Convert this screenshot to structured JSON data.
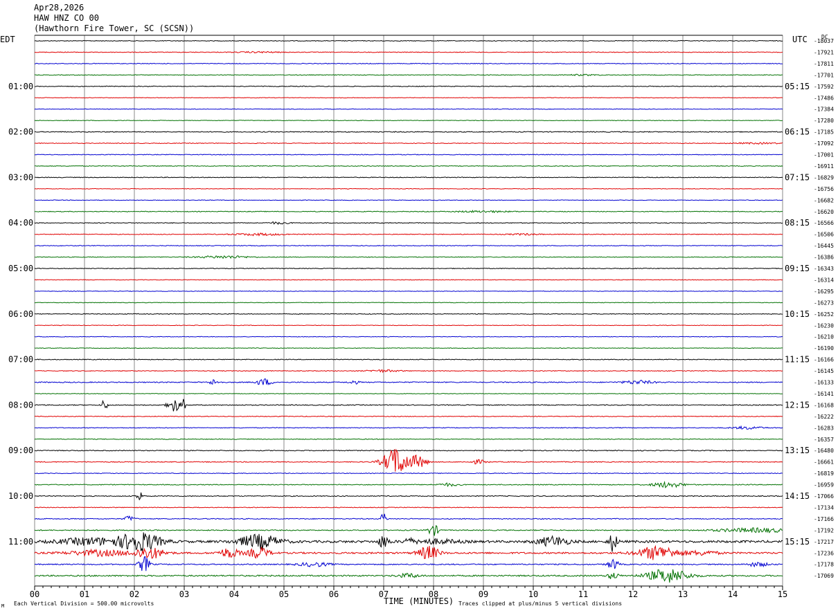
{
  "header": {
    "date": "Apr28,2026",
    "station": "HAW HNZ CO 00",
    "location": "(Hawthorn Fire Tower, SC (SCSN))"
  },
  "left_timezone": "EDT",
  "right_timezone": "UTC",
  "dc_label": "DC",
  "footer": {
    "scale_note": "Each Vertical Division =  500.00 microvolts",
    "xlabel": "TIME (MINUTES)",
    "clip_note": "Traces clipped at plus/minus 5 vertical divisions",
    "corner_mark": "M"
  },
  "colors": {
    "trace_cycle": [
      "#000000",
      "#e00000",
      "#0000d0",
      "#007000"
    ],
    "grid": "#8a8a8a"
  },
  "chart_data": {
    "type": "line",
    "title": "HAW HNZ CO 00",
    "xlabel": "TIME (MINUTES)",
    "xlim": [
      0,
      15
    ],
    "x_ticks": [
      "00",
      "01",
      "02",
      "03",
      "04",
      "05",
      "06",
      "07",
      "08",
      "09",
      "10",
      "11",
      "12",
      "13",
      "14",
      "15"
    ],
    "trace_minutes": 15,
    "left_hour_labels": [
      "01:00",
      "02:00",
      "03:00",
      "04:00",
      "05:00",
      "06:00",
      "07:00",
      "08:00",
      "09:00",
      "10:00",
      "11:00"
    ],
    "right_hour_labels": [
      "05:15",
      "06:15",
      "07:15",
      "08:15",
      "09:15",
      "10:15",
      "11:15",
      "12:15",
      "13:15",
      "14:15",
      "15:15"
    ],
    "dc_offsets": [
      -18037,
      -17921,
      -17811,
      -17701,
      -17592,
      -17486,
      -17384,
      -17280,
      -17185,
      -17092,
      -17001,
      -16911,
      -16829,
      -16756,
      -16682,
      -16620,
      -16566,
      -16506,
      -16445,
      -16386,
      -16343,
      -16314,
      -16295,
      -16273,
      -16252,
      -16230,
      -16210,
      -16190,
      -16166,
      -16145,
      -16133,
      -16141,
      -16168,
      -16222,
      -16283,
      -16357,
      -16480,
      -16661,
      -16819,
      -16959,
      -17066,
      -17134,
      -17166,
      -17192,
      -17217,
      -17236,
      -17178,
      -17069
    ],
    "activity": [
      {
        "row": 0,
        "level": 0.5,
        "bursts": []
      },
      {
        "row": 1,
        "level": 0.5,
        "bursts": [
          [
            4.5,
            0.4,
            0.8
          ]
        ]
      },
      {
        "row": 2,
        "level": 0.5,
        "bursts": []
      },
      {
        "row": 3,
        "level": 0.5,
        "bursts": [
          [
            11.0,
            0.3,
            0.8
          ]
        ]
      },
      {
        "row": 4,
        "level": 0.5,
        "bursts": []
      },
      {
        "row": 5,
        "level": 0.4,
        "bursts": []
      },
      {
        "row": 6,
        "level": 0.4,
        "bursts": []
      },
      {
        "row": 7,
        "level": 0.4,
        "bursts": []
      },
      {
        "row": 8,
        "level": 0.6,
        "bursts": []
      },
      {
        "row": 9,
        "level": 0.5,
        "bursts": [
          [
            14.5,
            0.5,
            0.8
          ]
        ]
      },
      {
        "row": 10,
        "level": 0.5,
        "bursts": []
      },
      {
        "row": 11,
        "level": 0.5,
        "bursts": []
      },
      {
        "row": 12,
        "level": 0.5,
        "bursts": []
      },
      {
        "row": 13,
        "level": 0.4,
        "bursts": []
      },
      {
        "row": 14,
        "level": 0.4,
        "bursts": []
      },
      {
        "row": 15,
        "level": 0.5,
        "bursts": [
          [
            9.0,
            0.5,
            1.2
          ]
        ]
      },
      {
        "row": 16,
        "level": 0.5,
        "bursts": [
          [
            4.9,
            0.2,
            1.5
          ]
        ]
      },
      {
        "row": 17,
        "level": 0.5,
        "bursts": [
          [
            4.5,
            0.5,
            1.5
          ],
          [
            9.8,
            0.3,
            1.0
          ]
        ]
      },
      {
        "row": 18,
        "level": 0.5,
        "bursts": []
      },
      {
        "row": 19,
        "level": 0.5,
        "bursts": [
          [
            3.8,
            0.5,
            1.8
          ]
        ]
      },
      {
        "row": 20,
        "level": 0.5,
        "bursts": []
      },
      {
        "row": 21,
        "level": 0.4,
        "bursts": []
      },
      {
        "row": 22,
        "level": 0.4,
        "bursts": []
      },
      {
        "row": 23,
        "level": 0.4,
        "bursts": []
      },
      {
        "row": 24,
        "level": 0.5,
        "bursts": []
      },
      {
        "row": 25,
        "level": 0.4,
        "bursts": []
      },
      {
        "row": 26,
        "level": 0.4,
        "bursts": []
      },
      {
        "row": 27,
        "level": 0.4,
        "bursts": []
      },
      {
        "row": 28,
        "level": 0.5,
        "bursts": []
      },
      {
        "row": 29,
        "level": 0.5,
        "bursts": [
          [
            7.0,
            0.3,
            1.5
          ]
        ]
      },
      {
        "row": 30,
        "level": 0.7,
        "bursts": [
          [
            3.6,
            0.1,
            4
          ],
          [
            4.6,
            0.15,
            5
          ],
          [
            6.4,
            0.1,
            2.5
          ],
          [
            12.1,
            0.3,
            2.5
          ]
        ]
      },
      {
        "row": 31,
        "level": 0.4,
        "bursts": []
      },
      {
        "row": 32,
        "level": 0.6,
        "bursts": [
          [
            1.4,
            0.05,
            10
          ],
          [
            2.8,
            0.12,
            10
          ],
          [
            3.0,
            0.03,
            10
          ]
        ]
      },
      {
        "row": 33,
        "level": 0.5,
        "bursts": []
      },
      {
        "row": 34,
        "level": 0.5,
        "bursts": [
          [
            14.3,
            0.3,
            2
          ]
        ]
      },
      {
        "row": 35,
        "level": 0.5,
        "bursts": []
      },
      {
        "row": 36,
        "level": 0.6,
        "bursts": []
      },
      {
        "row": 37,
        "level": 0.6,
        "bursts": [
          [
            7.25,
            0.25,
            20
          ],
          [
            7.7,
            0.15,
            9
          ],
          [
            8.9,
            0.15,
            3
          ]
        ]
      },
      {
        "row": 38,
        "level": 0.5,
        "bursts": []
      },
      {
        "row": 39,
        "level": 0.6,
        "bursts": [
          [
            12.7,
            0.3,
            4
          ],
          [
            8.3,
            0.2,
            2
          ]
        ]
      },
      {
        "row": 40,
        "level": 0.6,
        "bursts": [
          [
            2.1,
            0.05,
            10
          ]
        ]
      },
      {
        "row": 41,
        "level": 0.5,
        "bursts": []
      },
      {
        "row": 42,
        "level": 0.6,
        "bursts": [
          [
            7.0,
            0.05,
            10
          ],
          [
            1.9,
            0.1,
            4
          ]
        ]
      },
      {
        "row": 43,
        "level": 0.7,
        "bursts": [
          [
            8.0,
            0.1,
            8
          ],
          [
            14.5,
            0.8,
            3
          ]
        ]
      },
      {
        "row": 44,
        "level": 1.6,
        "bursts": [
          [
            1.1,
            0.6,
            5
          ],
          [
            2.1,
            0.4,
            14
          ],
          [
            4.5,
            0.4,
            10
          ],
          [
            7.0,
            0.1,
            9
          ],
          [
            7.5,
            0.05,
            9
          ],
          [
            10.4,
            0.3,
            7
          ],
          [
            11.6,
            0.08,
            14
          ],
          [
            8.0,
            0.5,
            3
          ]
        ]
      },
      {
        "row": 45,
        "level": 1.2,
        "bursts": [
          [
            1.3,
            0.6,
            4
          ],
          [
            2.3,
            0.3,
            8
          ],
          [
            3.9,
            0.2,
            7
          ],
          [
            4.5,
            0.2,
            8
          ],
          [
            7.9,
            0.2,
            10
          ],
          [
            12.5,
            0.4,
            10
          ],
          [
            13.4,
            0.3,
            3
          ]
        ]
      },
      {
        "row": 46,
        "level": 0.8,
        "bursts": [
          [
            2.2,
            0.1,
            12
          ],
          [
            5.6,
            0.3,
            3
          ],
          [
            11.6,
            0.1,
            8
          ],
          [
            14.5,
            0.2,
            3
          ]
        ]
      },
      {
        "row": 47,
        "level": 1.0,
        "bursts": [
          [
            12.7,
            0.4,
            10
          ],
          [
            11.6,
            0.1,
            5
          ],
          [
            7.5,
            0.2,
            3
          ]
        ]
      }
    ]
  }
}
